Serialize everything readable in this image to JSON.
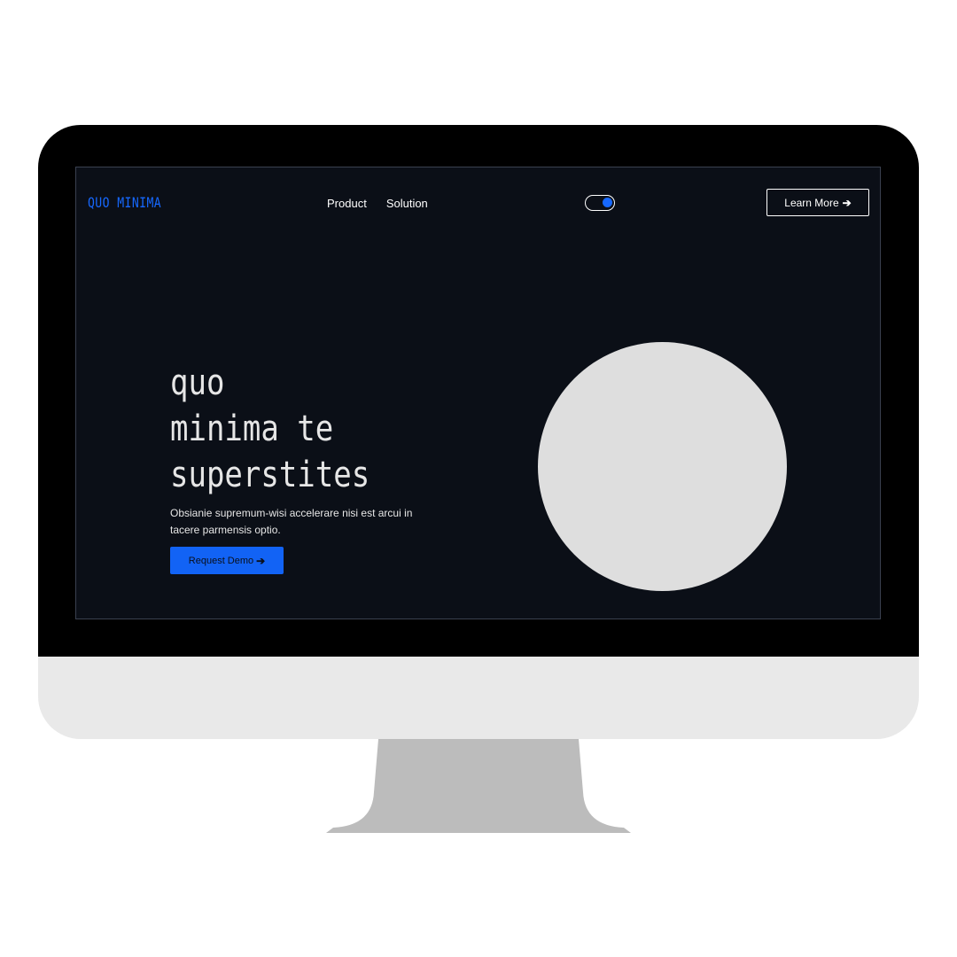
{
  "header": {
    "logo": "QUO MINIMA",
    "nav": [
      "Product",
      "Solution"
    ],
    "learn_more": {
      "label": "Learn More",
      "icon": "arrow-right-icon",
      "glyph": "➔"
    }
  },
  "theme_toggle": {
    "state": "on",
    "knob_color": "#1668ff"
  },
  "hero": {
    "title_lines": [
      "quo",
      "minima te",
      "superstites"
    ],
    "description": "Obsianie supremum-wisi accelerare nisi est arcui in tacere parmensis optio.",
    "cta": {
      "label": "Request Demo",
      "icon": "arrow-right-icon",
      "glyph": "➔"
    }
  },
  "colors": {
    "screen_bg": "#0b0f17",
    "accent": "#1668ff",
    "text": "#e6e6e6",
    "circle": "#dedede"
  }
}
